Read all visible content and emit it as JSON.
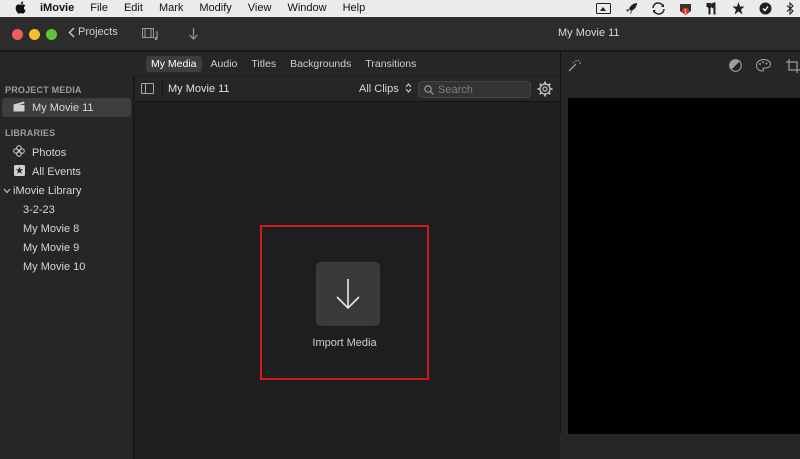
{
  "menubar": {
    "app_name": "iMovie",
    "items": [
      "File",
      "Edit",
      "Mark",
      "Modify",
      "View",
      "Window",
      "Help"
    ],
    "status_icons": [
      "screen-mirror-icon",
      "rocket-icon",
      "sync-icon",
      "notification-badge-icon",
      "tools-icon",
      "star-icon",
      "shield-icon",
      "bluetooth-icon"
    ]
  },
  "toolbar": {
    "projects_label": "Projects",
    "window_title": "My Movie 11"
  },
  "tabs": [
    {
      "label": "My Media",
      "active": true
    },
    {
      "label": "Audio",
      "active": false
    },
    {
      "label": "Titles",
      "active": false
    },
    {
      "label": "Backgrounds",
      "active": false
    },
    {
      "label": "Transitions",
      "active": false
    }
  ],
  "sidebar": {
    "project_header": "PROJECT MEDIA",
    "project_item": "My Movie 11",
    "libraries_header": "LIBRARIES",
    "photos": "Photos",
    "all_events": "All Events",
    "library": "iMovie Library",
    "events": [
      "3-2-23",
      "My Movie 8",
      "My Movie 9",
      "My Movie 10"
    ]
  },
  "browser": {
    "title": "My Movie 11",
    "filter_value": "All Clips",
    "search_placeholder": "Search"
  },
  "import": {
    "label": "Import Media"
  },
  "colors": {
    "highlight_frame": "#d4161d",
    "panel_bg": "#262626",
    "content_bg": "#1e1e1e"
  }
}
